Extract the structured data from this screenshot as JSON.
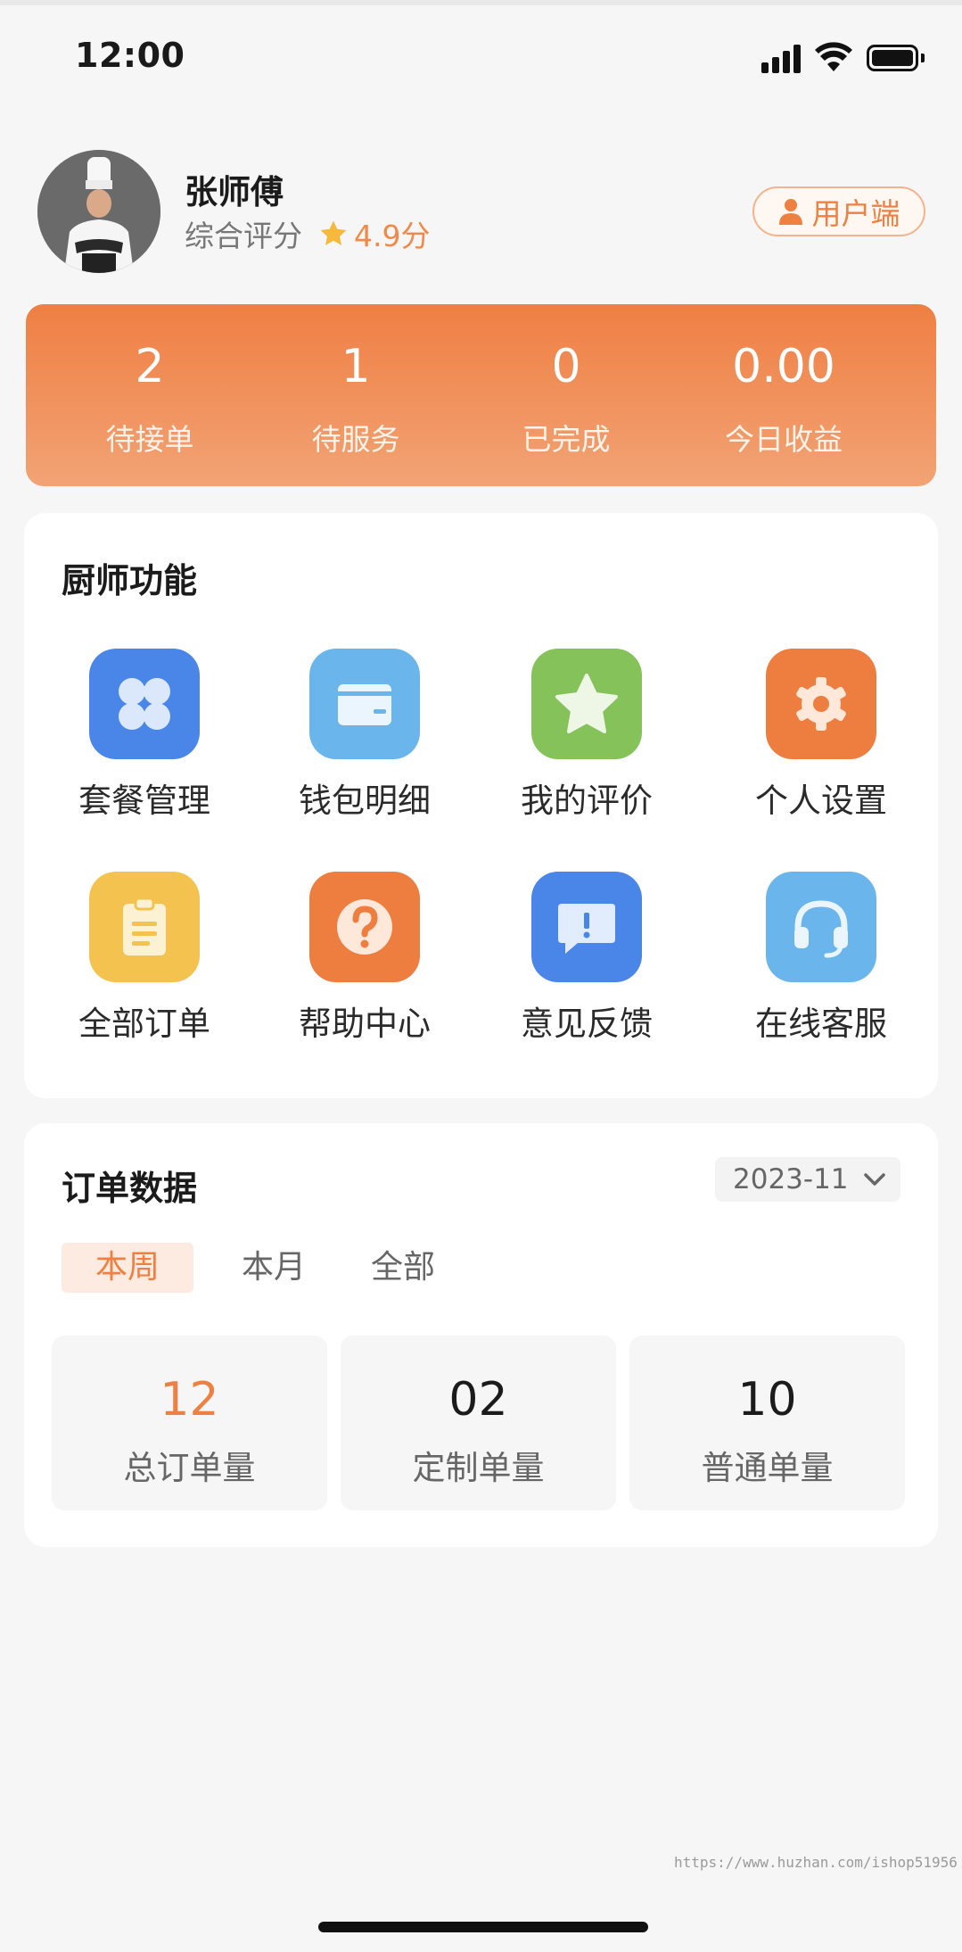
{
  "status_bar": {
    "time": "12:00"
  },
  "profile": {
    "name": "张师傅",
    "rating_label": "综合评分",
    "rating_value": "4.9分",
    "switch_button_label": "用户端"
  },
  "stats": [
    {
      "value": "2",
      "label": "待接单"
    },
    {
      "value": "1",
      "label": "待服务"
    },
    {
      "value": "0",
      "label": "已完成"
    },
    {
      "value": "0.00",
      "label": "今日收益"
    }
  ],
  "functions": {
    "title": "厨师功能",
    "items": [
      {
        "label": "套餐管理",
        "icon": "grid-icon",
        "color": "#4a86e8"
      },
      {
        "label": "钱包明细",
        "icon": "wallet-icon",
        "color": "#6ab5ec"
      },
      {
        "label": "我的评价",
        "icon": "star-icon",
        "color": "#86c25a"
      },
      {
        "label": "个人设置",
        "icon": "gear-icon",
        "color": "#ee7d40"
      },
      {
        "label": "全部订单",
        "icon": "clipboard-icon",
        "color": "#f4c24f"
      },
      {
        "label": "帮助中心",
        "icon": "question-icon",
        "color": "#ee7d40"
      },
      {
        "label": "意见反馈",
        "icon": "feedback-icon",
        "color": "#4a86e8"
      },
      {
        "label": "在线客服",
        "icon": "headset-icon",
        "color": "#6ab5ec"
      }
    ]
  },
  "orders": {
    "title": "订单数据",
    "month": "2023-11",
    "tabs": [
      "本周",
      "本月",
      "全部"
    ],
    "active_tab": "本周",
    "boxes": [
      {
        "value": "12",
        "label": "总订单量"
      },
      {
        "value": "02",
        "label": "定制单量"
      },
      {
        "value": "10",
        "label": "普通单量"
      }
    ]
  },
  "watermark": "https://www.huzhan.com/ishop51956",
  "colors": {
    "accent": "#ee8142",
    "background": "#f6f6f6"
  }
}
